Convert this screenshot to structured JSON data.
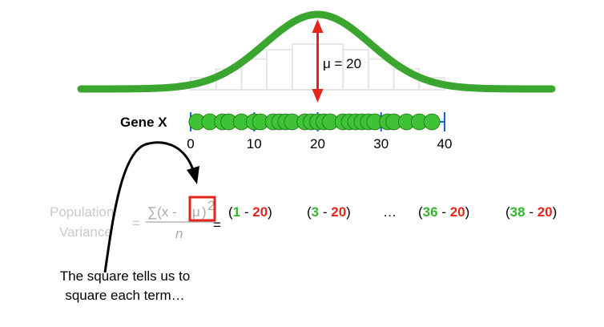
{
  "distribution": {
    "mean_label": "μ = 20",
    "mean": 20,
    "curve_color": "#3aa52f",
    "arrow_color": "#e5251c",
    "histogram_color": "#e6e6e6"
  },
  "number_line": {
    "label": "Gene X",
    "ticks": [
      "0",
      "10",
      "20",
      "30",
      "40"
    ],
    "tick_values": [
      0,
      10,
      20,
      30,
      40
    ],
    "min": 0,
    "max": 40,
    "line_color": "#1a63c9",
    "dot_color": "#3ec236",
    "points": [
      1,
      3,
      5,
      6,
      8,
      10,
      11,
      13,
      14,
      15,
      16,
      18,
      19,
      20,
      21,
      22,
      24,
      25,
      26,
      27,
      28,
      29,
      31,
      32,
      34,
      36,
      38
    ]
  },
  "formula": {
    "population": "Population",
    "variance": "Variance",
    "equals_left": "=",
    "numerator_sum": "∑(x - ",
    "mu": "μ",
    "close_paren": ")",
    "exponent": "2",
    "denominator": "n",
    "equals_right": "=",
    "highlight_color": "#e5251c"
  },
  "terms": [
    {
      "open": "(",
      "value": "1",
      "sep": " - ",
      "mean": "20",
      "close": ")"
    },
    {
      "open": "(",
      "value": "3",
      "sep": " - ",
      "mean": "20",
      "close": ")"
    },
    {
      "open": "(",
      "value": "36",
      "sep": " - ",
      "mean": "20",
      "close": ")"
    },
    {
      "open": "(",
      "value": "38",
      "sep": " - ",
      "mean": "20",
      "close": ")"
    }
  ],
  "ellipsis": "…",
  "annotation": {
    "line1": "The square tells us to",
    "line2": "square each term…"
  }
}
